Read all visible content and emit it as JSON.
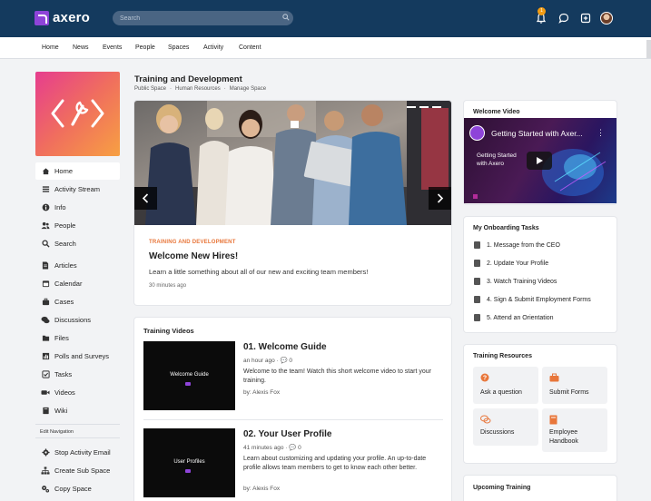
{
  "app": {
    "brand": "axero",
    "search_placeholder": "Search",
    "notification_count": "1"
  },
  "nav": [
    "Home",
    "News",
    "Events",
    "People",
    "Spaces",
    "Activity",
    "Content"
  ],
  "sidebar": {
    "items": [
      "Home",
      "Activity Stream",
      "Info",
      "People",
      "Search",
      "Articles",
      "Calendar",
      "Cases",
      "Discussions",
      "Files",
      "Polls and Surveys",
      "Tasks",
      "Videos",
      "Wiki"
    ],
    "edit_heading": "Edit Navigation",
    "edit_items": [
      "Stop Activity Email",
      "Create Sub Space",
      "Copy Space"
    ]
  },
  "page": {
    "title": "Training and Development",
    "breadcrumbs": [
      "Public Space",
      "Human Resources",
      "Manage Space"
    ]
  },
  "announcement": {
    "category": "TRAINING AND DEVELOPMENT",
    "title": "Welcome New Hires!",
    "description": "Learn a little something about all of our new and exciting team members!",
    "time": "30 minutes ago"
  },
  "training_videos": {
    "heading": "Training Videos",
    "items": [
      {
        "thumb_label": "Welcome Guide",
        "title": "01. Welcome Guide",
        "time": "an hour ago",
        "comments": "0",
        "desc": "Welcome to the team! Watch this short welcome video to start your training.",
        "by": "by: Alexis Fox"
      },
      {
        "thumb_label": "User Profiles",
        "title": "02. Your User Profile",
        "time": "41 minutes ago",
        "comments": "0",
        "desc": "Learn about customizing and updating your profile. An up-to-date profile allows team members to get to know each other better.",
        "by": "by: Alexis Fox"
      }
    ]
  },
  "welcome_video": {
    "heading": "Welcome Video",
    "video_title": "Getting Started with Axer...",
    "overlay_text": "Getting Started with Axero"
  },
  "onboarding": {
    "heading": "My Onboarding Tasks",
    "tasks": [
      "1. Message from the CEO",
      "2. Update Your Profile",
      "3. Watch Training Videos",
      "4. Sign & Submit Employment Forms",
      "5. Attend an Orientation"
    ]
  },
  "resources": {
    "heading": "Training Resources",
    "tiles": [
      "Ask a question",
      "Submit Forms",
      "Discussions",
      "Employee Handbook"
    ]
  },
  "upcoming": {
    "heading": "Upcoming Training"
  },
  "colors": {
    "topbar": "#143a5e",
    "accent": "#e8763a",
    "brand": "#8e44d9"
  }
}
